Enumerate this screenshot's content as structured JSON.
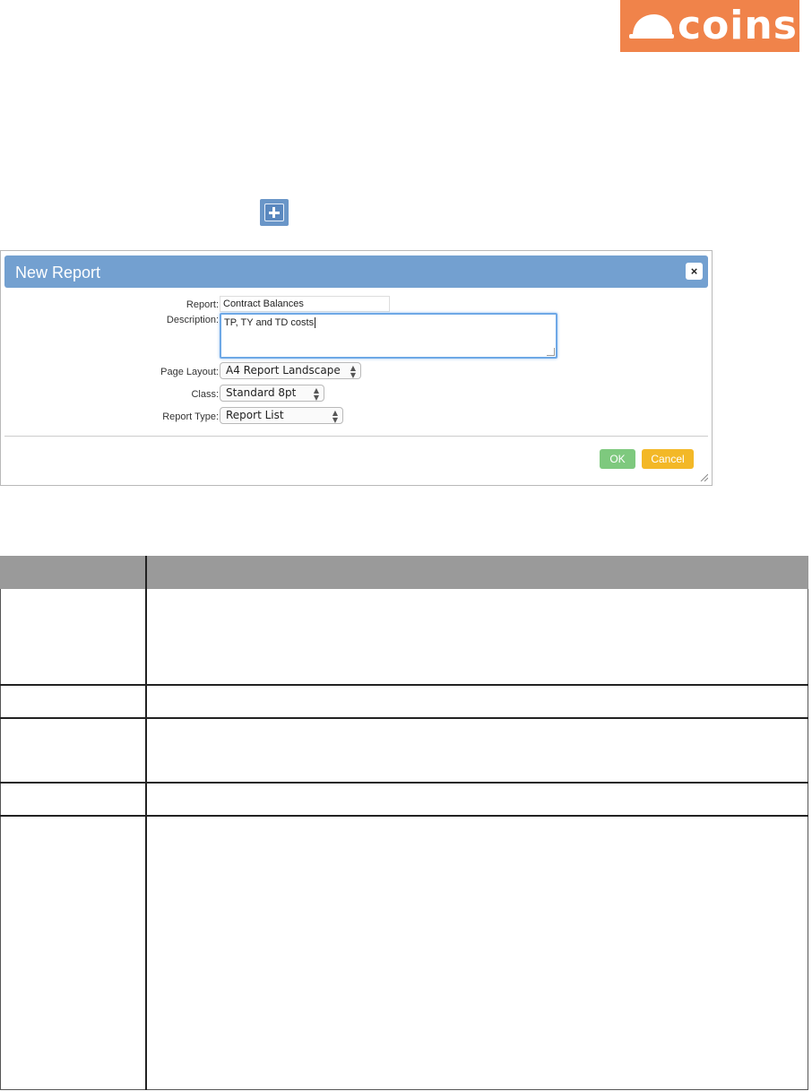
{
  "logo": {
    "text": "coins",
    "color": "#f0834a"
  },
  "toolbar": {
    "add_icon": "plus-icon"
  },
  "dialog": {
    "title": "New Report",
    "close_glyph": "×",
    "fields": {
      "report_label": "Report:",
      "report_value": "Contract Balances",
      "description_label": "Description:",
      "description_value": "TP, TY and TD costs",
      "page_layout_label": "Page Layout:",
      "page_layout_value": "A4 Report Landscape",
      "class_label": "Class:",
      "class_value": "Standard 8pt",
      "report_type_label": "Report Type:",
      "report_type_value": "Report List"
    },
    "buttons": {
      "ok": "OK",
      "cancel": "Cancel"
    },
    "header_color": "#73a0d0",
    "ok_color": "#7ec97e",
    "cancel_color": "#f3b827"
  },
  "table": {
    "header_color": "#9a9a9a",
    "rows": 5
  }
}
